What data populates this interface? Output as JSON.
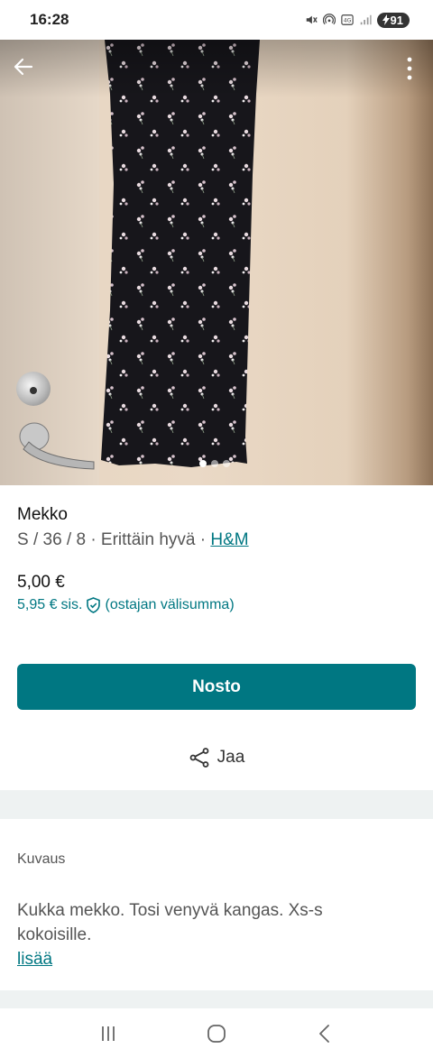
{
  "status_bar": {
    "time": "16:28",
    "battery": "91",
    "icons": [
      "mute-icon",
      "hotspot-icon",
      "volte-icon",
      "signal-icon"
    ]
  },
  "photo": {
    "image_count": 3,
    "active_index": 0,
    "icons": [
      "back-arrow-icon",
      "more-vert-icon"
    ]
  },
  "item": {
    "title": "Mekko",
    "subtitle_prefix": "S / 36 / 8 · Erittäin hyvä · ",
    "brand": "H&M",
    "price": "5,00 €",
    "price_incl_amount": "5,95 €",
    "price_incl_sis": "sis.",
    "price_incl_note": "(ostajan välisumma)"
  },
  "actions": {
    "primary_label": "Nosto",
    "share_label": "Jaa"
  },
  "description": {
    "section_label": "Kuvaus",
    "text": "Kukka mekko. Tosi venyvä kangas. Xs-s kokoisille.",
    "more_label": "lisää"
  },
  "colors": {
    "accent": "#007782",
    "band": "#eef2f2"
  }
}
